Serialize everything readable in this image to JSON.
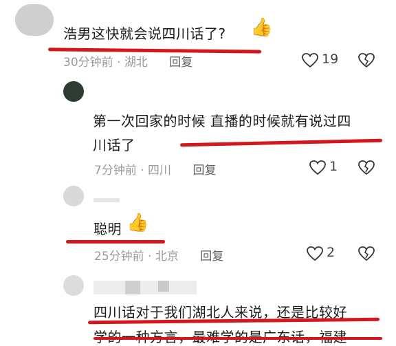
{
  "comments": [
    {
      "text": "浩男这快就会说四川话了?",
      "time": "30分钟前",
      "location": "湖北",
      "reply": "回复",
      "likes": "19"
    },
    {
      "text_line1": "第一次回家的时候 直播的时候就有说过四",
      "text_line2": "川话了",
      "time": "7分钟前",
      "location": "四川",
      "reply": "回复",
      "likes": "1"
    },
    {
      "text": "聪明",
      "time": "25分钟前",
      "location": "北京",
      "reply": "回复",
      "likes": "2"
    },
    {
      "text_line1": "四川话对于我们湖北人来说，还是比较好",
      "text_line2": "学的一种方言，最难学的是广东话，福建"
    }
  ],
  "separator": " · ",
  "icons": [
    "heart-icon",
    "broken-heart-icon",
    "thumbs-up-emoji"
  ],
  "colors": {
    "underline": "#d4161d",
    "meta": "#9a9a9a",
    "text": "#1a1a1a"
  }
}
